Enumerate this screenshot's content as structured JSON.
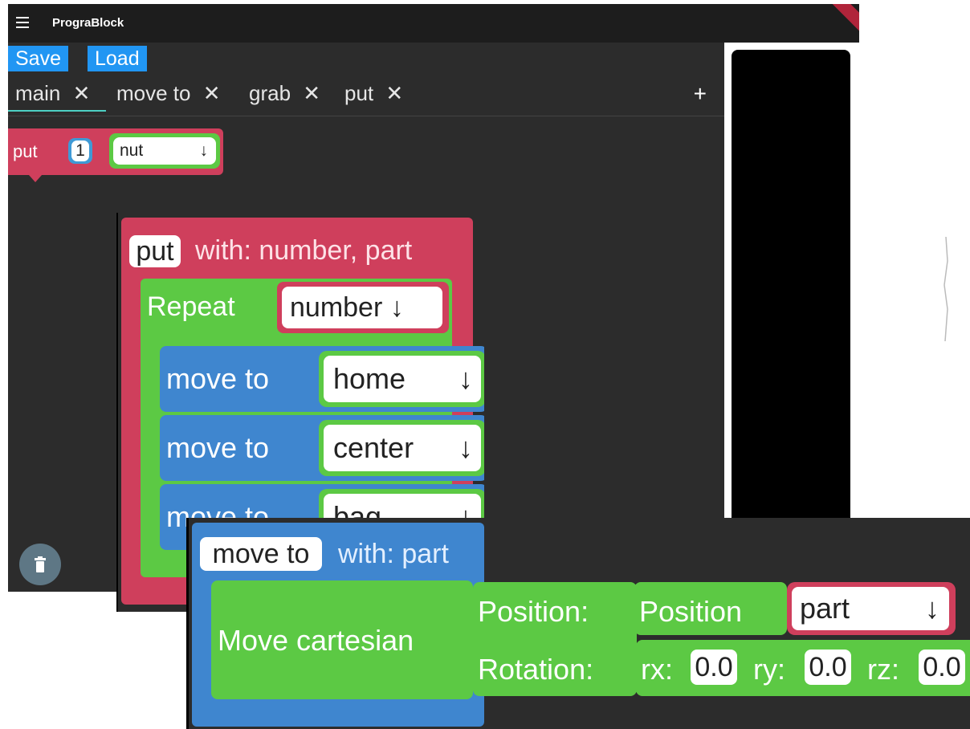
{
  "app": {
    "title": "PrograBlock"
  },
  "toolbar": {
    "save_label": "Save",
    "load_label": "Load"
  },
  "tabs": [
    {
      "label": "main",
      "close": "✕",
      "active": true
    },
    {
      "label": "move to",
      "close": "✕"
    },
    {
      "label": "grab",
      "close": "✕"
    },
    {
      "label": "put",
      "close": "✕"
    }
  ],
  "tab_add": "+",
  "workspace_block": {
    "keyword": "put",
    "number": "1",
    "part": "nut",
    "dropdown_arrow": "↓"
  },
  "put_definition": {
    "name": "put",
    "params": "with: number, part",
    "repeat_label": "Repeat",
    "repeat_var": "number",
    "steps": [
      {
        "label": "move to",
        "target": "home"
      },
      {
        "label": "move to",
        "target": "center"
      },
      {
        "label": "move to",
        "target": "bag"
      }
    ],
    "dropdown_arrow": "↓"
  },
  "move_to_definition": {
    "name": "move to",
    "params": "with: part",
    "move_label": "Move cartesian",
    "position_label": "Position:",
    "position_block": "Position",
    "position_var": "part",
    "rotation_label": "Rotation:",
    "rx_label": "rx:",
    "rx": "0.0",
    "ry_label": "ry:",
    "ry": "0.0",
    "rz_label": "rz:",
    "rz": "0.0",
    "dropdown_arrow": "↓"
  },
  "colors": {
    "procedure": "#cf3f5c",
    "loop": "#5cc944",
    "motion": "#3f86cf",
    "number": "#3f9ad6",
    "accent": "#2196f3"
  }
}
